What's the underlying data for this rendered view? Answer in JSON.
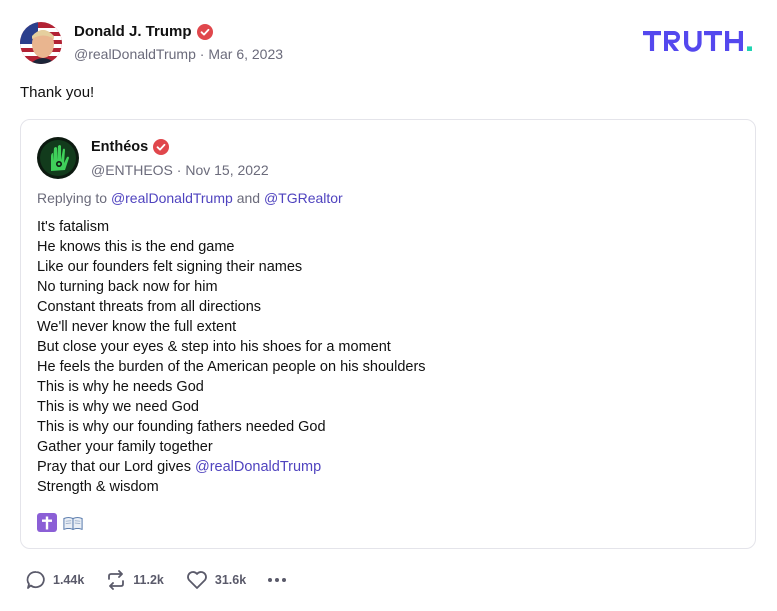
{
  "post": {
    "author_name": "Donald J. Trump",
    "handle": "@realDonaldTrump",
    "separator": "·",
    "date": "Mar 6, 2023",
    "text": "Thank you!"
  },
  "logo": {
    "text": "TRUTH",
    "dot": ".",
    "color": "#5448ee",
    "dot_color": "#20d4b2"
  },
  "quote": {
    "author_name": "Enthéos",
    "handle": "@ENTHEOS",
    "separator": "·",
    "date": "Nov 15, 2022",
    "reply_prefix": "Replying to",
    "reply_mention_1": "@realDonaldTrump",
    "reply_and": "and",
    "reply_mention_2": "@TGRealtor",
    "lines": [
      "It's fatalism",
      "He knows this is the end game",
      "Like our founders felt signing their names",
      "No turning back now for him",
      "Constant threats from all directions",
      "We'll never know the full extent",
      "But close your eyes & step into his shoes for a moment",
      "He feels the burden of the American people on his shoulders",
      "This is why he needs God",
      "This is why we need God",
      "This is why our founding fathers needed God",
      "Gather your family together"
    ],
    "pray_prefix": "Pray that our Lord gives",
    "pray_mention": "@realDonaldTrump",
    "last_line": "Strength & wisdom",
    "emoji_icons": [
      "latin-cross-icon",
      "open-book-icon"
    ]
  },
  "actions": {
    "replies": "1.44k",
    "retruths": "11.2k",
    "likes": "31.6k"
  },
  "colors": {
    "accent": "#4f43bf",
    "verified": "#e0474c",
    "muted": "#6b6b7b"
  }
}
